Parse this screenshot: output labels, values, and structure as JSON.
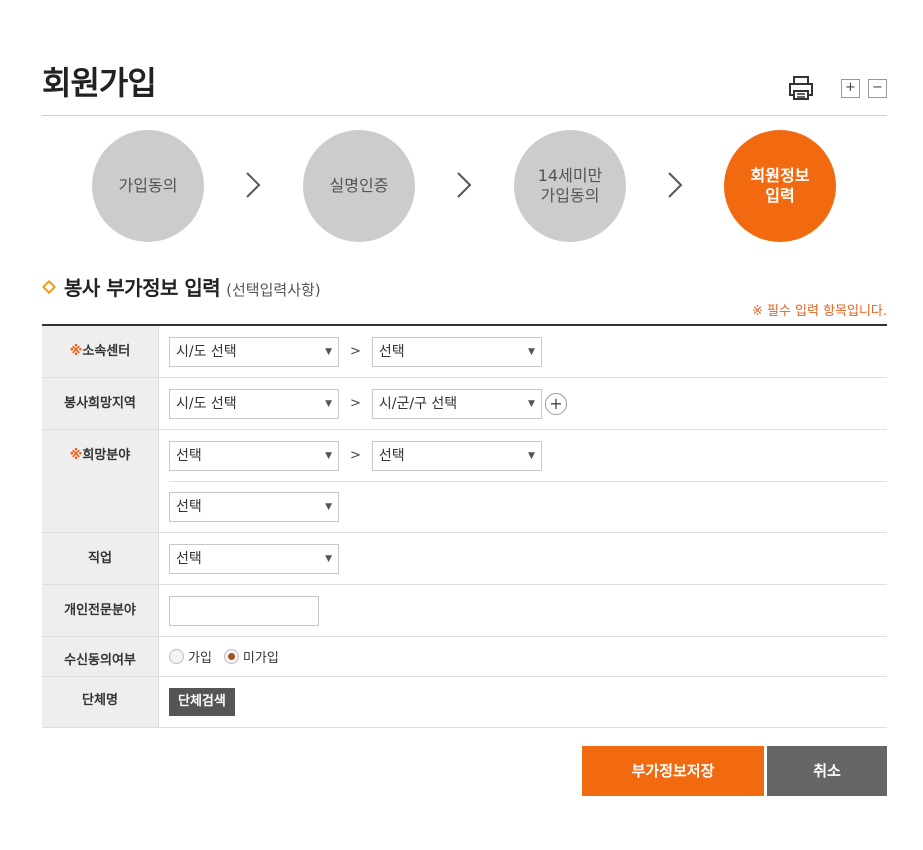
{
  "page": {
    "title": "회원가입",
    "zoom_in_label": "+",
    "zoom_out_label": "−"
  },
  "steps": [
    {
      "label": "가입동의",
      "active": false
    },
    {
      "label": "실명인증",
      "active": false
    },
    {
      "label": "14세미만\n가입동의",
      "active": false
    },
    {
      "label": "회원정보\n입력",
      "active": true
    }
  ],
  "section": {
    "title": "봉사 부가정보 입력",
    "subtitle": "(선택입력사항)",
    "required_note": "※ 필수 입력 항목입니다."
  },
  "form": {
    "required_mark": "※",
    "center": {
      "label": "소속센터",
      "select1": "시/도 선택",
      "select2": "선택"
    },
    "region": {
      "label": "봉사희망지역",
      "select1": "시/도 선택",
      "select2": "시/군/구 선택",
      "add_label": "+"
    },
    "field": {
      "label": "희망분야",
      "select1": "선택",
      "select2": "선택",
      "select3": "선택"
    },
    "job": {
      "label": "직업",
      "select1": "선택"
    },
    "expertise": {
      "label": "개인전문분야",
      "value": ""
    },
    "consent": {
      "label": "수신동의여부",
      "options": [
        {
          "label": "가입",
          "checked": false
        },
        {
          "label": "미가입",
          "checked": true
        }
      ]
    },
    "group": {
      "label": "단체명",
      "button": "단체검색"
    },
    "separator": ">",
    "arrow": "▼"
  },
  "actions": {
    "save": "부가정보저장",
    "cancel": "취소"
  },
  "colors": {
    "accent": "#f26a10",
    "inactive_step": "#cccccc",
    "dark_button": "#555555"
  }
}
